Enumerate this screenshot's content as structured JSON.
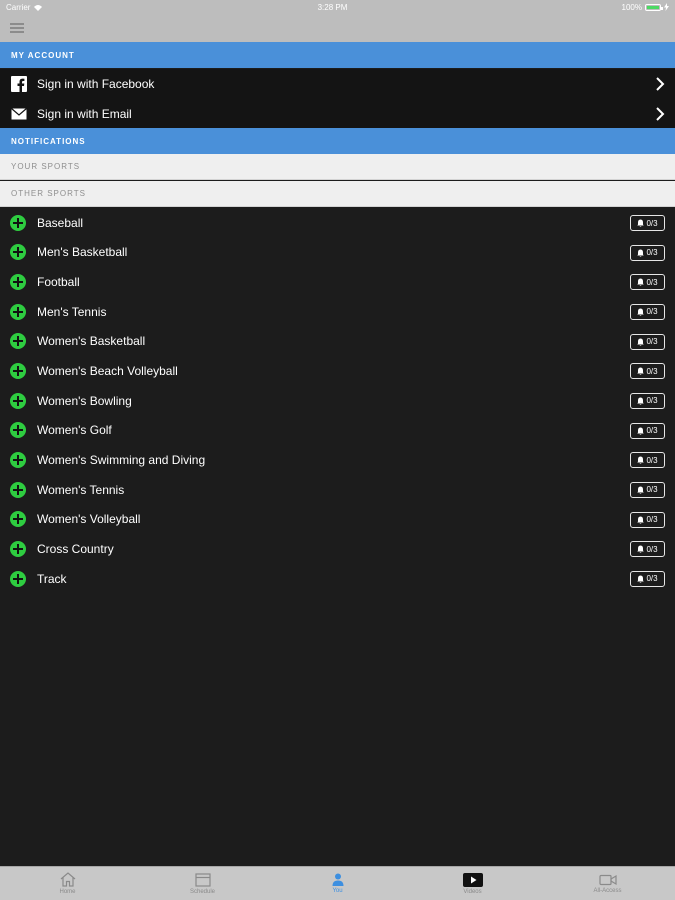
{
  "status_bar": {
    "carrier": "Carrier",
    "time": "3:28 PM",
    "battery": "100%"
  },
  "account": {
    "header": "MY ACCOUNT",
    "facebook_label": "Sign in with Facebook",
    "email_label": "Sign in with Email"
  },
  "notifications": {
    "header": "NOTIFICATIONS",
    "your_sports": "YOUR SPORTS",
    "other_sports": "OTHER SPORTS"
  },
  "sports": [
    {
      "name": "Baseball",
      "count": "0/3"
    },
    {
      "name": "Men's Basketball",
      "count": "0/3"
    },
    {
      "name": "Football",
      "count": "0/3"
    },
    {
      "name": "Men's Tennis",
      "count": "0/3"
    },
    {
      "name": "Women's Basketball",
      "count": "0/3"
    },
    {
      "name": "Women's Beach Volleyball",
      "count": "0/3"
    },
    {
      "name": "Women's Bowling",
      "count": "0/3"
    },
    {
      "name": "Women's Golf",
      "count": "0/3"
    },
    {
      "name": "Women's Swimming and Diving",
      "count": "0/3"
    },
    {
      "name": "Women's Tennis",
      "count": "0/3"
    },
    {
      "name": "Women's Volleyball",
      "count": "0/3"
    },
    {
      "name": "Cross Country",
      "count": "0/3"
    },
    {
      "name": "Track",
      "count": "0/3"
    }
  ],
  "tabs": [
    {
      "label": "Home",
      "icon": "home-icon"
    },
    {
      "label": "Schedule",
      "icon": "calendar-icon"
    },
    {
      "label": "You",
      "icon": "person-icon",
      "active": true
    },
    {
      "label": "Videos",
      "icon": "play-icon"
    },
    {
      "label": "All-Access",
      "icon": "video-camera-icon"
    }
  ],
  "colors": {
    "section_header": "#4a90d9",
    "plus_green": "#2ecc40",
    "active_tab": "#3d8fe0"
  }
}
